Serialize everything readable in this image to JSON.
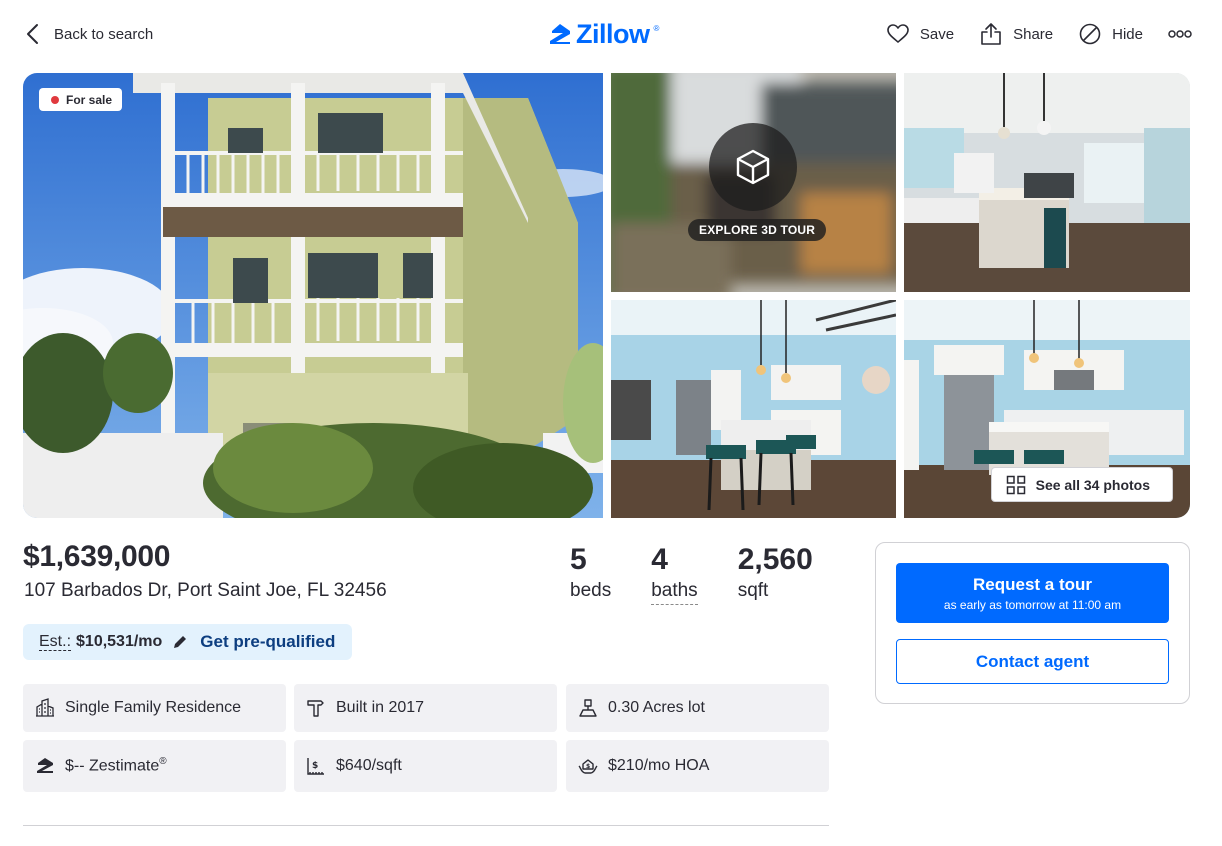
{
  "header": {
    "back_label": "Back to search",
    "logo_text": "Zillow",
    "logo_mark": "®",
    "actions": {
      "save": "Save",
      "share": "Share",
      "hide": "Hide"
    }
  },
  "gallery": {
    "status_badge": "For sale",
    "tour_label": "EXPLORE 3D TOUR",
    "see_all_label": "See all 34 photos"
  },
  "listing": {
    "price": "$1,639,000",
    "address": "107 Barbados Dr, Port Saint Joe, FL 32456",
    "stats": [
      {
        "value": "5",
        "label": "beds"
      },
      {
        "value": "4",
        "label": "baths"
      },
      {
        "value": "2,560",
        "label": "sqft"
      }
    ],
    "estimate": {
      "label": "Est.:",
      "value": "$10,531/mo",
      "action": "Get pre-qualified"
    }
  },
  "facts": [
    {
      "icon": "property-type-icon",
      "text": "Single Family Residence"
    },
    {
      "icon": "hammer-icon",
      "text": "Built in 2017"
    },
    {
      "icon": "lot-icon",
      "text": "0.30 Acres lot"
    },
    {
      "icon": "zestimate-icon",
      "text": "$-- Zestimate",
      "sup": "®"
    },
    {
      "icon": "price-per-sqft-icon",
      "text": "$640/sqft"
    },
    {
      "icon": "hoa-icon",
      "text": "$210/mo HOA"
    }
  ],
  "contact": {
    "tour_button": "Request a tour",
    "tour_subtext": "as early as tomorrow at 11:00 am",
    "contact_button": "Contact agent"
  },
  "colors": {
    "brand_blue": "#006aff",
    "status_red": "#e0393e",
    "estimate_bg": "#e3f2fd",
    "fact_bg": "#f1f1f4",
    "text": "#2a2a33"
  }
}
